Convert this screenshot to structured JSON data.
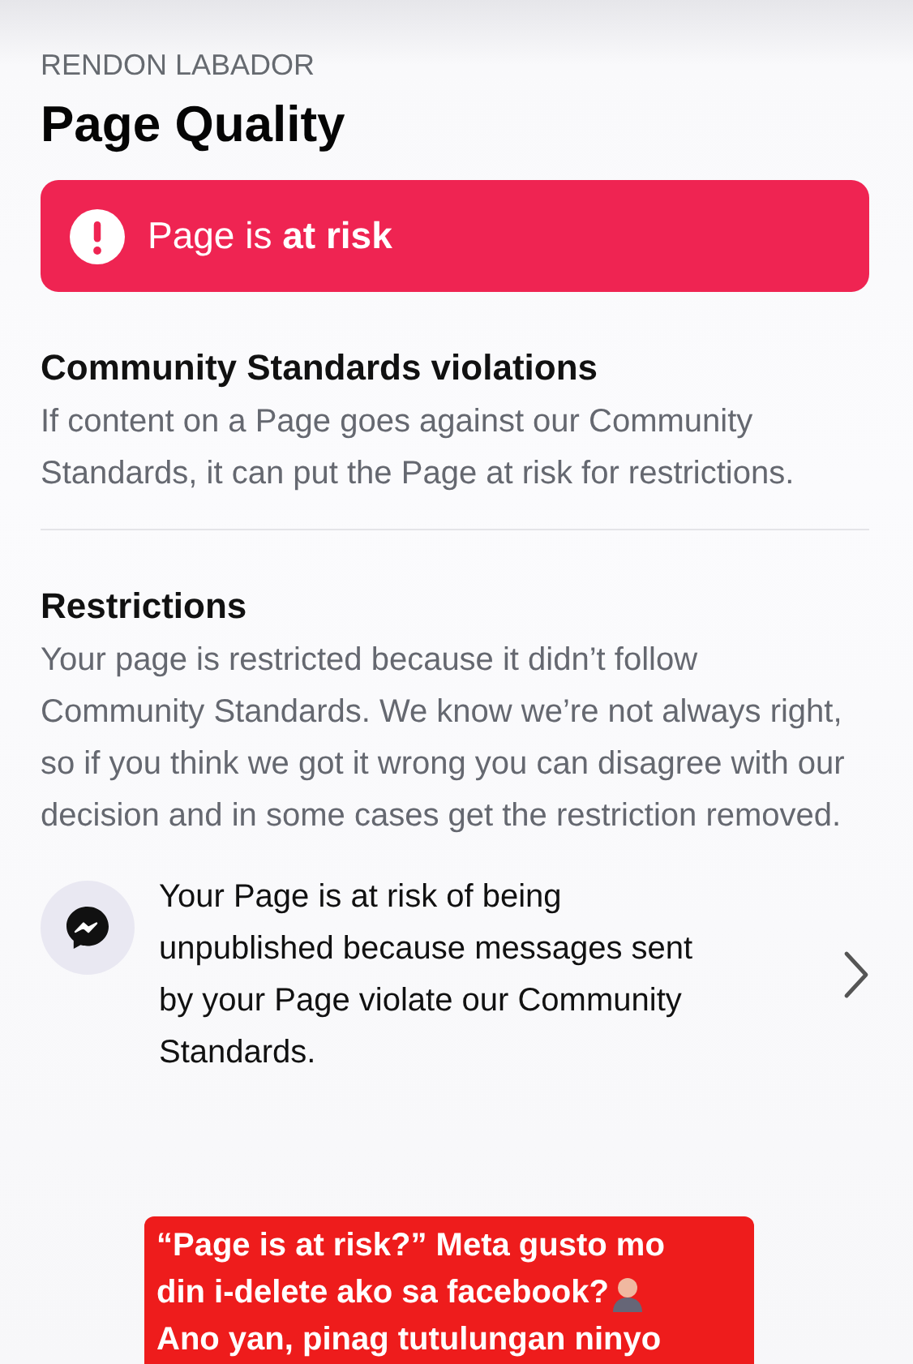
{
  "page_name": "RENDON LABADOR",
  "title": "Page Quality",
  "status_banner": {
    "text": "Page is **at risk**"
  },
  "sections": [
    {
      "heading": "Community Standards violations",
      "body": "If content on a Page goes against our Community Standards, it can put the Page at risk for restrictions."
    },
    {
      "heading": "Restrictions",
      "body": "Your page is restricted because it didn’t follow Community Standards. We know we’re not always right, so if you think we got it wrong you can disagree with our decision and in some cases get the restriction removed."
    }
  ],
  "restriction_item": {
    "text": "Your Page is at risk of being unpublished because messages sent by your Page violate our Community Standards."
  },
  "caption": {
    "lines": [
      "“Page is at risk?” Meta gusto mo",
      "din i-delete ako sa facebook?",
      "Ano yan, pinag tutulungan ninyo"
    ]
  }
}
